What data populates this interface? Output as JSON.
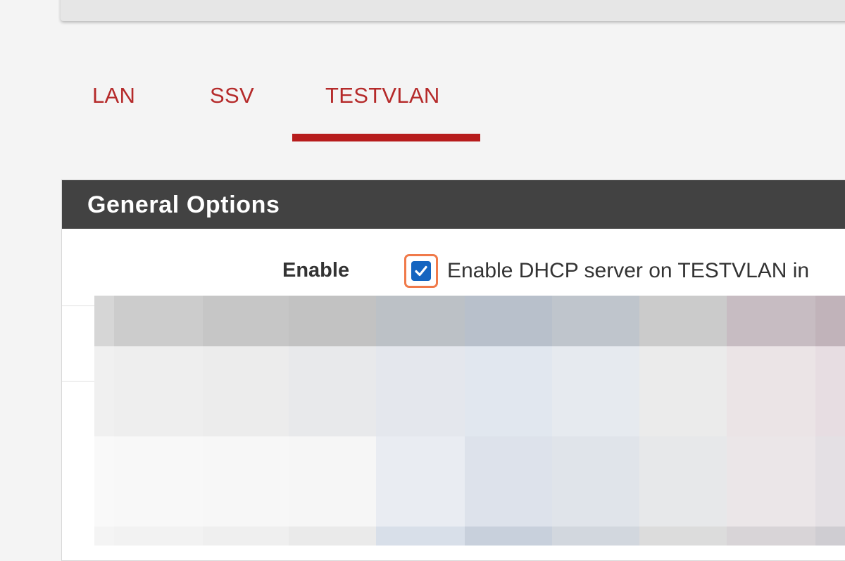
{
  "tabs": [
    {
      "label": "LAN",
      "active": false
    },
    {
      "label": "SSV",
      "active": false
    },
    {
      "label": "TESTVLAN",
      "active": true
    }
  ],
  "panel": {
    "title": "General Options"
  },
  "enable_row": {
    "label": "Enable",
    "checked": true,
    "help": "Enable DHCP server on TESTVLAN in"
  },
  "colors": {
    "accent": "#b71c1c",
    "tab_text": "#b52a2a",
    "panel_heading": "#424242",
    "checkbox": "#1565c0",
    "highlight": "#f07a4a"
  }
}
